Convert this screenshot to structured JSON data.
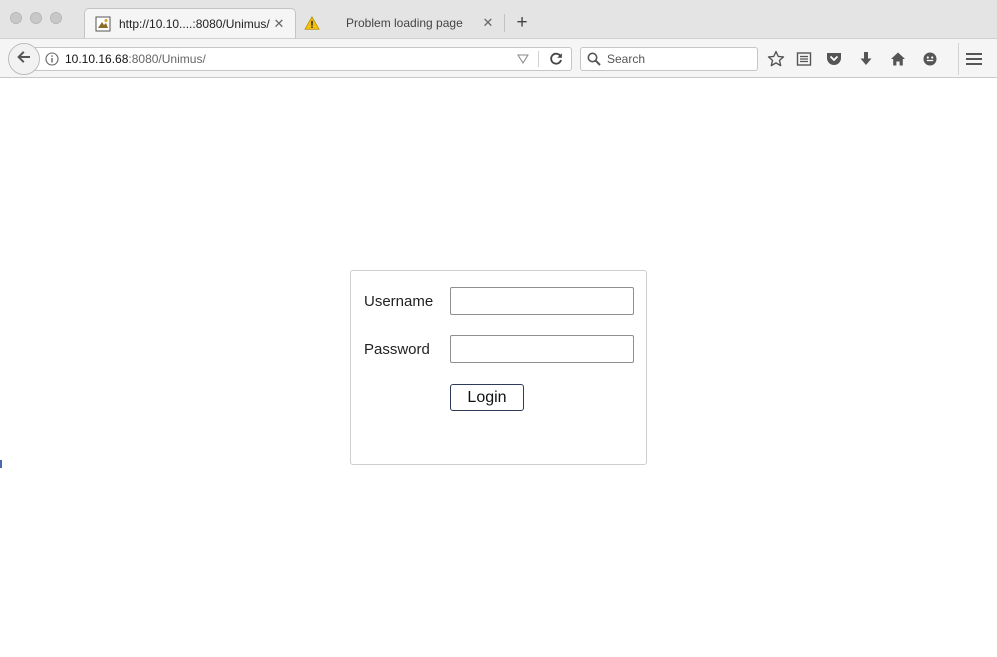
{
  "tabs": [
    {
      "title": "http://10.10....:8080/Unimus/",
      "active": true,
      "favicon": "page-favicon-icon"
    },
    {
      "title": "Problem loading page",
      "active": false,
      "favicon": "warning-icon"
    }
  ],
  "tab_close_glyph": "✕",
  "new_tab_glyph": "+",
  "navbar": {
    "url_host": "10.10.16.68",
    "url_rest": ":8080/Unimus/",
    "search_placeholder": "Search"
  },
  "login": {
    "username_label": "Username",
    "password_label": "Password",
    "username_value": "",
    "password_value": "",
    "button_label": "Login"
  },
  "colors": {
    "accent_border": "#2e3a5a",
    "warning": "#f4c20d"
  }
}
